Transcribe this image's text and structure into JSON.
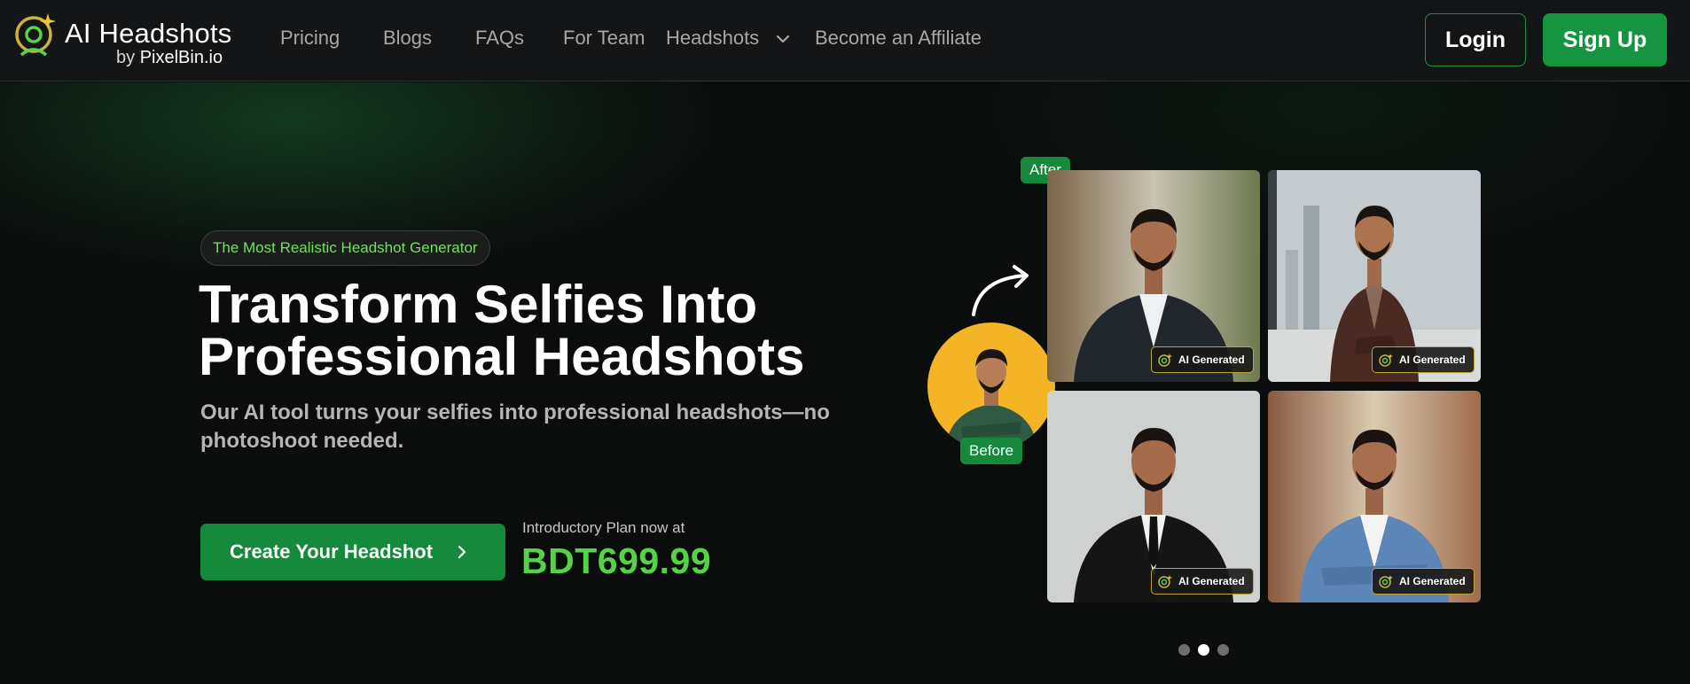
{
  "brand": {
    "title": "AI Headshots",
    "by": "by",
    "company": "PixelBin.io",
    "accent": "#15953f",
    "logo_icon": "sparkle-person-icon"
  },
  "nav": {
    "links": [
      "Pricing",
      "Blogs",
      "FAQs",
      "For Team",
      "Headshots",
      "Become an Affiliate"
    ],
    "login": "Login",
    "signup": "Sign Up"
  },
  "hero": {
    "badge": "The Most Realistic Headshot Generator",
    "headline": "Transform Selfies Into Professional Headshots",
    "subhead": "Our AI tool turns your selfies into professional headshots—no photoshoot needed.",
    "cta": "Create Your Headshot",
    "intro_label": "Introductory Plan now at",
    "price": "BDT699.99"
  },
  "gallery": {
    "after_label": "After",
    "before_label": "Before",
    "ai_tag": "AI Generated",
    "photos": [
      {
        "name": "office-dark-suit",
        "bg": "#8a7a5c",
        "suit": "#22262d"
      },
      {
        "name": "city-brown-blazer",
        "bg": "#b9c0c4",
        "suit": "#4a2a22"
      },
      {
        "name": "grey-black-suit",
        "bg": "#cfd0cf",
        "suit": "#141414"
      },
      {
        "name": "street-blue-blazer",
        "bg": "#b48a6c",
        "suit": "#5d86b8"
      }
    ]
  },
  "carousel": {
    "dots": 3,
    "active": 1
  }
}
